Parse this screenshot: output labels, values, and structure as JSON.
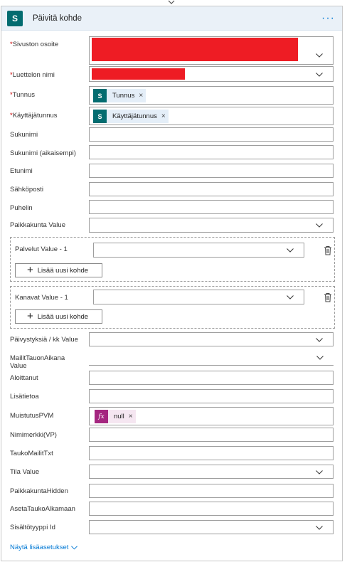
{
  "header": {
    "title": "Päivitä kohde",
    "more_label": "···",
    "logo_letter": "S"
  },
  "fields": {
    "site_address": {
      "label": "Sivuston osoite",
      "required": "*"
    },
    "list_name": {
      "label": "Luettelon nimi",
      "required": "*"
    },
    "tunnus": {
      "label": "Tunnus",
      "required": "*",
      "token": "Tunnus"
    },
    "kayttajatunnus": {
      "label": "Käyttäjätunnus",
      "required": "*",
      "token": "Käyttäjätunnus"
    },
    "sukunimi": {
      "label": "Sukunimi"
    },
    "sukunimi_aik": {
      "label": "Sukunimi (aikaisempi)"
    },
    "etunimi": {
      "label": "Etunimi"
    },
    "sahkoposti": {
      "label": "Sähköposti"
    },
    "puhelin": {
      "label": "Puhelin"
    },
    "paikkakunta": {
      "label": "Paikkakunta Value"
    },
    "paivystyksia": {
      "label": "Päivystyksiä / kk Value"
    },
    "mailit_tauon": {
      "label": "MailitTauonAikana Value"
    },
    "aloittanut": {
      "label": "Aloittanut"
    },
    "lisatietoa": {
      "label": "Lisätietoa"
    },
    "muistutus": {
      "label": "MuistutusPVM",
      "token": "null",
      "token_icon": "fx"
    },
    "nimimerkki": {
      "label": "Nimimerkki(VP)"
    },
    "taukomailit": {
      "label": "TaukoMailitTxt"
    },
    "tila": {
      "label": "Tila Value"
    },
    "paikkakunta_hidden": {
      "label": "PaikkakuntaHidden"
    },
    "aseta_tauko": {
      "label": "AsetaTaukoAlkamaan"
    },
    "sisaltotyyppi": {
      "label": "Sisältötyyppi Id"
    }
  },
  "groups": {
    "palvelut": {
      "label": "Palvelut Value - 1",
      "add_label": "Lisää uusi kohde"
    },
    "kanavat": {
      "label": "Kanavat Value - 1",
      "add_label": "Lisää uusi kohde"
    }
  },
  "footer": {
    "more_settings": "Näytä lisäasetukset"
  },
  "colors": {
    "accent": "#0078d4",
    "sharepoint": "#036c70",
    "expression": "#a4267f",
    "redaction": "#ee1c24"
  }
}
